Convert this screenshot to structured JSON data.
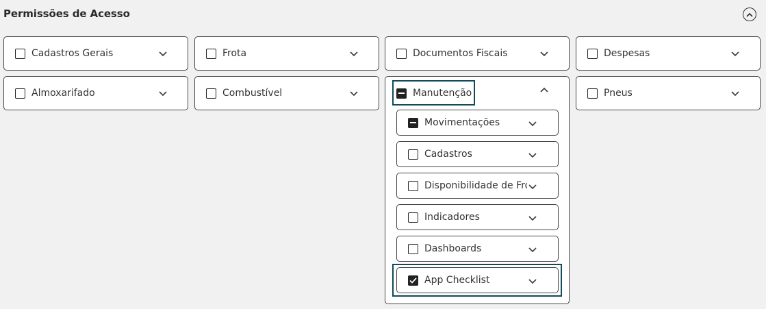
{
  "title": "Permissões de Acesso",
  "icons": {
    "collapse": "chevron-up-circle-icon",
    "expand": "chevron-down-icon",
    "collapse_card": "chevron-up-icon"
  },
  "colors": {
    "highlight": "#0f4b5a"
  },
  "row1": [
    {
      "label": "Cadastros Gerais",
      "state": "unchecked"
    },
    {
      "label": "Frota",
      "state": "unchecked"
    },
    {
      "label": "Documentos Fiscais",
      "state": "unchecked"
    },
    {
      "label": "Despesas",
      "state": "unchecked"
    }
  ],
  "row2": [
    {
      "label": "Almoxarifado",
      "state": "unchecked"
    },
    {
      "label": "Combustível",
      "state": "unchecked"
    },
    {
      "label": "Manutenção",
      "state": "indeterminate",
      "expanded": true
    },
    {
      "label": "Pneus",
      "state": "unchecked"
    }
  ],
  "manutencao": {
    "items": [
      {
        "label": "Movimentações",
        "state": "indeterminate"
      },
      {
        "label": "Cadastros",
        "state": "unchecked"
      },
      {
        "label": "Disponibilidade de Frota",
        "state": "unchecked"
      },
      {
        "label": "Indicadores",
        "state": "unchecked"
      },
      {
        "label": "Dashboards",
        "state": "unchecked"
      },
      {
        "label": "App Checklist",
        "state": "checked"
      }
    ]
  }
}
